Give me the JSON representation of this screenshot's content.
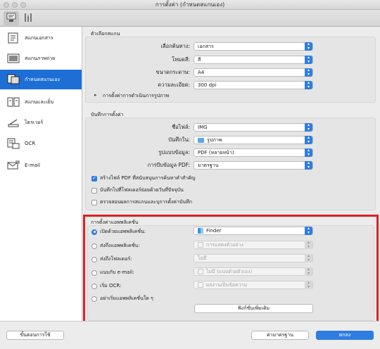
{
  "window": {
    "title": "การตั้งค่า (กำหนดสแกนเอง)"
  },
  "toolbar": {
    "icons": [
      "scan-settings-icon",
      "general-settings-icon"
    ]
  },
  "sidebar": {
    "items": [
      {
        "label": "สแกนเอกสาร",
        "icon": "document-scan-icon"
      },
      {
        "label": "สแกนภาพถ่าย",
        "icon": "photo-scan-icon"
      },
      {
        "label": "กำหนดสแกนเอง",
        "icon": "custom-scan-icon",
        "active": true
      },
      {
        "label": "สแกนและเย็บ",
        "icon": "scan-stitch-icon"
      },
      {
        "label": "ไดรเวอร์",
        "icon": "driver-icon"
      },
      {
        "label": "OCR",
        "icon": "ocr-icon"
      },
      {
        "label": "E-mail",
        "icon": "email-icon"
      }
    ]
  },
  "scan_options": {
    "title": "ตัวเลือกสแกน",
    "select_source_label": "เลือกต้นทาง:",
    "select_source_value": "เอกสาร",
    "color_mode_label": "โหมดสี:",
    "color_mode_value": "สี",
    "paper_size_label": "ขนาดกระดาษ:",
    "paper_size_value": "A4",
    "resolution_label": "ความละเอียด:",
    "resolution_value": "300 dpi",
    "image_processing_label": "การตั้งค่าการดำเนินการรูปภาพ"
  },
  "save_settings": {
    "title": "บันทึกการตั้งค่า",
    "file_name_label": "ชื่อไฟล์:",
    "file_name_value": "IMG",
    "save_in_label": "บันทึกใน:",
    "save_in_value": "รูปภาพ",
    "data_format_label": "รูปแบบข้อมูล:",
    "data_format_value": "PDF (หลายหน้า)",
    "pdf_compression_label": "การบีบข้อมูล PDF:",
    "pdf_compression_value": "มาตรฐาน",
    "checkbox_1": "สร้างไฟล์ PDF ที่สนับสนุนการค้นหาคำสำคัญ",
    "checkbox_1_checked": true,
    "checkbox_2": "บันทึกไปที่โฟลเดอร์ย่อยด้วยวันที่ปัจจุบัน",
    "checkbox_2_checked": false,
    "checkbox_3": "ตรวจสอบผลการสแกนและบุการตั้งค่าบันทึก",
    "checkbox_3_checked": false
  },
  "app_settings": {
    "title": "การตั้งค่าแอพพลิเคชั่น",
    "open_app_label": "เปิดด้วยแอพพลิเคชั่น:",
    "open_app_value": "Finder",
    "send_to_app_label": "ส่งถึงแอพพลิเคชั่น:",
    "send_to_app_value": "การแสดงตัวอย่าง",
    "send_to_folder_label": "ส่งถึงโฟลเดอร์:",
    "send_to_folder_value": "ไม่มี",
    "attach_email_label": "แนบกับ e-mail:",
    "attach_email_value": "ไม่มี (แนบด้วยตัวเอง)",
    "start_ocr_label": "เริ่ม OCR:",
    "start_ocr_value": "ผลงานเป็นข้อความ",
    "no_app_label": "อย่าเริ่มแอพพลิเคชั่นใด ๆ",
    "more_functions_label": "ฟังก์ชั่นเพิ่มเติม",
    "selected": "open_app"
  },
  "footer": {
    "instructions_label": "ขั้นตอนการใช้",
    "defaults_label": "ค่ามาตรฐาน",
    "ok_label": "ตกลง"
  },
  "colors": {
    "accent": "#2f7de1",
    "highlight": "#e02020",
    "sidebar_active": "#1d6fd6"
  }
}
